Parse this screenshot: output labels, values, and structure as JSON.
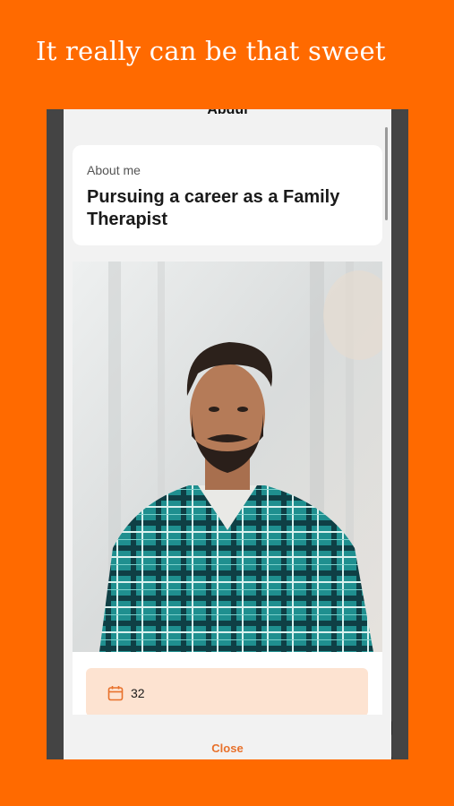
{
  "headline": "It really can be that sweet",
  "profile": {
    "name": "Abdul",
    "about_label": "About me",
    "about_text": "Pursuing a career as a Family Therapist",
    "age": "32"
  },
  "actions": {
    "close_label": "Close"
  },
  "icons": {
    "age": "calendar-icon"
  },
  "colors": {
    "background": "#FF6A00",
    "accent": "#E8712B",
    "age_card": "#FDE3D1"
  }
}
